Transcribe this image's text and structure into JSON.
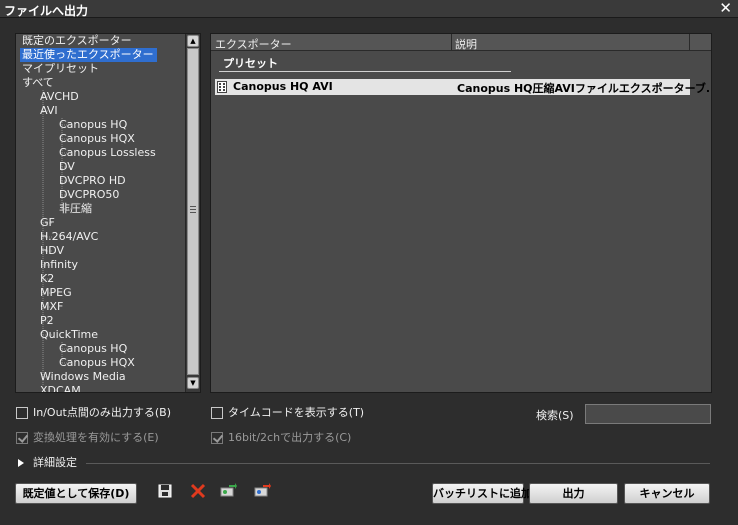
{
  "window": {
    "title": "ファイルへ出力",
    "close_label": "✕"
  },
  "tree": {
    "items": [
      {
        "label": "既定のエクスポーター",
        "level": 0,
        "selected": false
      },
      {
        "label": "最近使ったエクスポーター",
        "level": 0,
        "selected": true
      },
      {
        "label": "マイプリセット",
        "level": 0,
        "selected": false
      },
      {
        "label": "すべて",
        "level": 0,
        "selected": false
      },
      {
        "label": "AVCHD",
        "level": 1,
        "selected": false
      },
      {
        "label": "AVI",
        "level": 1,
        "selected": false
      },
      {
        "label": "Canopus HQ",
        "level": 2,
        "selected": false
      },
      {
        "label": "Canopus HQX",
        "level": 2,
        "selected": false
      },
      {
        "label": "Canopus Lossless",
        "level": 2,
        "selected": false
      },
      {
        "label": "DV",
        "level": 2,
        "selected": false
      },
      {
        "label": "DVCPRO HD",
        "level": 2,
        "selected": false
      },
      {
        "label": "DVCPRO50",
        "level": 2,
        "selected": false
      },
      {
        "label": "非圧縮",
        "level": 2,
        "selected": false
      },
      {
        "label": "GF",
        "level": 1,
        "selected": false
      },
      {
        "label": "H.264/AVC",
        "level": 1,
        "selected": false
      },
      {
        "label": "HDV",
        "level": 1,
        "selected": false
      },
      {
        "label": "Infinity",
        "level": 1,
        "selected": false
      },
      {
        "label": "K2",
        "level": 1,
        "selected": false
      },
      {
        "label": "MPEG",
        "level": 1,
        "selected": false
      },
      {
        "label": "MXF",
        "level": 1,
        "selected": false
      },
      {
        "label": "P2",
        "level": 1,
        "selected": false
      },
      {
        "label": "QuickTime",
        "level": 1,
        "selected": false
      },
      {
        "label": "Canopus HQ",
        "level": 2,
        "selected": false
      },
      {
        "label": "Canopus HQX",
        "level": 2,
        "selected": false
      },
      {
        "label": "Windows Media",
        "level": 1,
        "selected": false
      },
      {
        "label": "XDCAM",
        "level": 1,
        "selected": false
      }
    ]
  },
  "list": {
    "col_exporter": "エクスポーター",
    "col_description": "説明",
    "group_label": "プリセット",
    "selected_row": {
      "exporter": "Canopus HQ AVI",
      "description": "Canopus HQ圧縮AVIファイルエクスポーターブ..."
    }
  },
  "options": {
    "inout_only": {
      "label": "In/Out点間のみ出力する(B)",
      "checked": false,
      "enabled": true
    },
    "show_timecode": {
      "label": "タイムコードを表示する(T)",
      "checked": false,
      "enabled": true
    },
    "enable_conversion": {
      "label": "変換処理を有効にする(E)",
      "checked": true,
      "enabled": false
    },
    "output_16bit": {
      "label": "16bit/2chで出力する(C)",
      "checked": true,
      "enabled": false
    }
  },
  "search": {
    "label": "検索(S)",
    "value": ""
  },
  "advanced": {
    "label": "詳細設定"
  },
  "buttons": {
    "save_default": "既定値として保存(D)",
    "add_batch": "バッチリストに追加",
    "output": "出力",
    "cancel": "キャンセル"
  },
  "toolbar_icons": [
    "save-icon",
    "delete-icon",
    "import-icon",
    "export-icon"
  ],
  "colors": {
    "selection": "#2f6ecf",
    "panel_bg": "#4a4a4a",
    "window_bg": "#2d2d2d",
    "delete_red": "#e03a1e"
  }
}
